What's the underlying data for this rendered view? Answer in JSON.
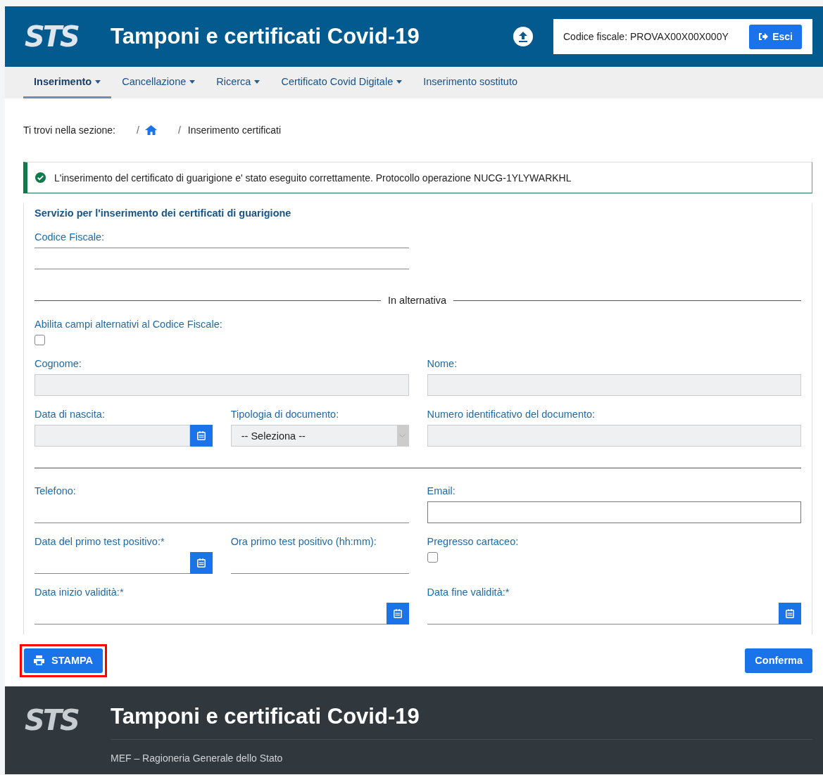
{
  "header": {
    "logo": "STS",
    "title": "Tamponi e certificati Covid-19",
    "user_label": "Codice fiscale: PROVAX00X00X000Y",
    "logout_button": "Esci"
  },
  "nav": [
    {
      "label": "Inserimento",
      "dropdown": true,
      "selected": true
    },
    {
      "label": "Cancellazione",
      "dropdown": true,
      "selected": false
    },
    {
      "label": "Ricerca",
      "dropdown": true,
      "selected": false
    },
    {
      "label": "Certificato Covid Digitale",
      "dropdown": true,
      "selected": false
    },
    {
      "label": "Inserimento sostituto",
      "dropdown": false,
      "selected": false
    }
  ],
  "breadcrumb": {
    "label": "Ti trovi nella sezione:",
    "separator": "/",
    "current": "Inserimento certificati"
  },
  "alert": {
    "message": "L'inserimento del certificato di guarigione e' stato eseguito correttamente. Protocollo operazione NUCG-1YLYWARKHL"
  },
  "form": {
    "title": "Servizio per l'inserimento dei certificati di guarigione",
    "rows": [
      {
        "kind": "fields",
        "fields": [
          {
            "label": "Codice Fiscale:",
            "kind": "text",
            "disabled": false,
            "focused": false
          }
        ]
      },
      {
        "kind": "separator",
        "label": "In alternativa"
      },
      {
        "kind": "fields",
        "fields": [
          {
            "label": "Abilita campi alternativi al Codice Fiscale:",
            "kind": "checkbox",
            "checked": false
          }
        ]
      },
      {
        "kind": "fields",
        "fields": [
          {
            "label": "Cognome:",
            "kind": "text",
            "disabled": true,
            "focused": false
          },
          {
            "label": "Nome:",
            "kind": "text",
            "disabled": true,
            "focused": false
          }
        ]
      },
      {
        "kind": "fields",
        "fields": [
          {
            "label": "Data di nascita:",
            "kind": "date",
            "disabled": true,
            "focused": false
          },
          {
            "label": "Tipologia di documento:",
            "kind": "select",
            "disabled": true,
            "value": "-- Seleziona --"
          },
          {
            "label": "Numero identificativo del documento:",
            "kind": "text",
            "disabled": true,
            "focused": false
          }
        ]
      },
      {
        "kind": "divider"
      },
      {
        "kind": "fields",
        "fields": [
          {
            "label": "Telefono:",
            "kind": "text",
            "disabled": false,
            "focused": false
          },
          {
            "label": "Email:",
            "kind": "text",
            "disabled": false,
            "focused": true
          }
        ]
      },
      {
        "kind": "fields",
        "fields": [
          {
            "label": "Data del primo test positivo:*",
            "kind": "date",
            "disabled": false,
            "focused": false
          },
          {
            "label": "Ora primo test positivo (hh:mm):",
            "kind": "text",
            "disabled": false,
            "focused": false
          },
          {
            "label": "Pregresso cartaceo:",
            "kind": "checkbox",
            "checked": false
          }
        ]
      },
      {
        "kind": "fields",
        "fields": [
          {
            "label": "Data inizio validità:*",
            "kind": "date",
            "disabled": false,
            "focused": false
          },
          {
            "label": "Data fine validità:*",
            "kind": "date",
            "disabled": false,
            "focused": false
          }
        ]
      }
    ]
  },
  "buttons": {
    "print": "STAMPA",
    "print_highlighted": true,
    "confirm": "Conferma"
  },
  "footer": {
    "logo": "STS",
    "title": "Tamponi e certificati Covid-19",
    "subtitle": "MEF – Ragioneria Generale dello Stato"
  }
}
